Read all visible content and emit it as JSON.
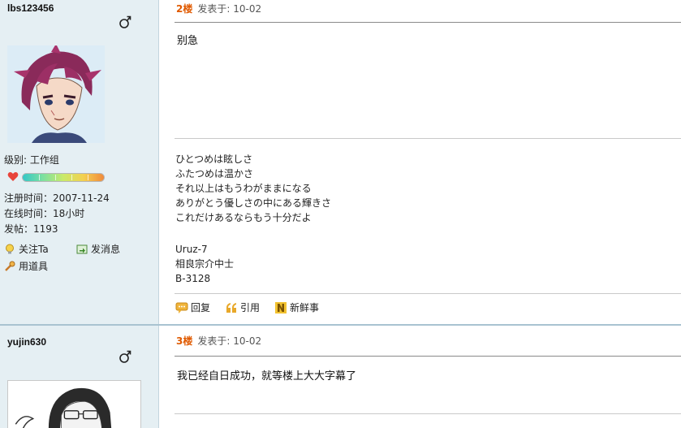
{
  "posts": [
    {
      "user": {
        "name": "lbs123456",
        "level_label": "级别: 工作组",
        "register": "注册时间：2007-11-24",
        "online": "在线时间：18小时",
        "posts": "发帖：1193",
        "actions": {
          "follow": "关注Ta",
          "message": "发消息",
          "tools": "用道具"
        }
      },
      "floor": "2楼",
      "time": "发表于: 10-02",
      "content": "别急",
      "signature": [
        "ひとつめは眩しさ",
        "ふたつめは温かさ",
        "それ以上はもうわがままになる",
        "ありがとう優しさの中にある輝きさ",
        "これだけあるならもう十分だよ",
        "",
        "Uruz-7",
        "相良宗介中士",
        "B-3128"
      ],
      "post_actions": {
        "reply": "回复",
        "quote": "引用",
        "news": "新鲜事"
      }
    },
    {
      "user": {
        "name": "yujin630"
      },
      "floor": "3楼",
      "time": "发表于: 10-02",
      "content": "我已经自日成功，就等楼上大大字幕了"
    }
  ],
  "colors": {
    "sidebar_bg": "#e5eff3",
    "floor_number": "#e05a00"
  },
  "icons": [
    "male-icon",
    "heart-icon",
    "bulb-icon",
    "message-icon",
    "wrench-icon",
    "reply-icon",
    "quote-icon",
    "news-icon"
  ]
}
